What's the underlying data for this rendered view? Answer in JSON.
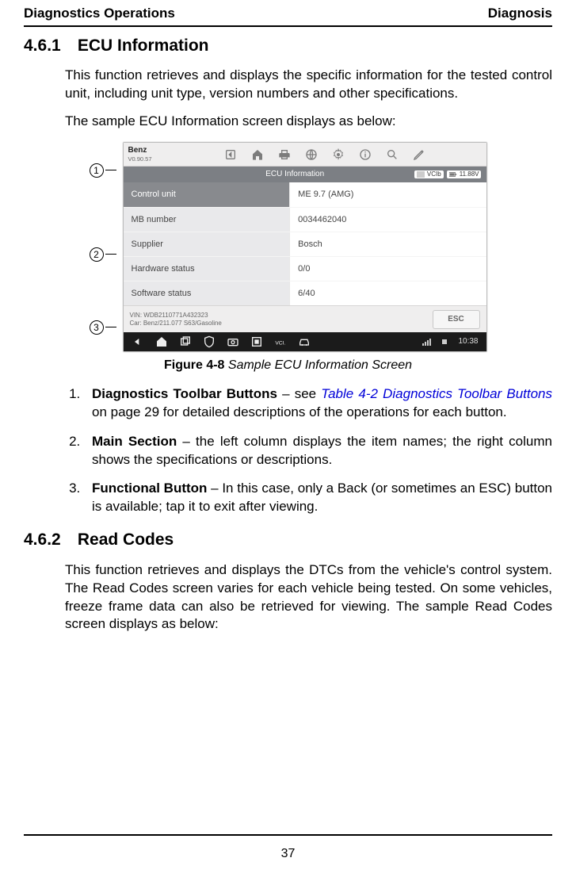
{
  "running_head": {
    "left": "Diagnostics Operations",
    "right": "Diagnosis"
  },
  "sections": {
    "s461": {
      "num": "4.6.1",
      "title": "ECU Information"
    },
    "s462": {
      "num": "4.6.2",
      "title": "Read Codes"
    }
  },
  "paras": {
    "p1": "This function retrieves and displays the specific information for the tested control unit, including unit type, version numbers and other specifications.",
    "p2": "The sample ECU Information screen displays as below:",
    "p3": "This function retrieves and displays the DTCs from the vehicle's control system. The Read Codes screen varies for each vehicle being tested. On some vehicles, freeze frame data can also be retrieved for viewing. The sample Read Codes screen displays as below:"
  },
  "callouts": {
    "c1": "1",
    "c2": "2",
    "c3": "3"
  },
  "screenshot": {
    "brand": {
      "name": "Benz",
      "version": "V0.90.57"
    },
    "subbar": {
      "title": "ECU Information",
      "vcib_label": "VCIb",
      "battery": "11.88V"
    },
    "rows": [
      {
        "name": "Control unit",
        "value": "ME 9.7 (AMG)",
        "header": true
      },
      {
        "name": "MB number",
        "value": "0034462040"
      },
      {
        "name": "Supplier",
        "value": "Bosch"
      },
      {
        "name": "Hardware status",
        "value": "0/0"
      },
      {
        "name": "Software status",
        "value": "6/40"
      }
    ],
    "footer": {
      "vin_line1": "VIN: WDB2110771A432323",
      "vin_line2": "Car: Benz/211.077 S63/Gasoline",
      "esc": "ESC"
    },
    "sysbar": {
      "time": "10:38"
    },
    "icons": {
      "back": "back-icon",
      "home": "home-icon",
      "print": "print-icon",
      "globe": "globe-icon",
      "settings": "settings-icon",
      "about": "about-icon",
      "search": "search-icon",
      "edit": "pencil-icon",
      "bottom": [
        "back-icon",
        "home-icon",
        "recent-icon",
        "shield-icon",
        "camera-icon",
        "screenshot-icon",
        "vci-icon",
        "car-icon"
      ]
    }
  },
  "figure": {
    "lead": "Figure 4-8",
    "title": "Sample ECU Information Screen"
  },
  "list": {
    "i1_lead": "Diagnostics Toolbar Buttons",
    "i1_dash": " – see ",
    "i1_link": "Table 4-2 Diagnostics Toolbar Buttons",
    "i1_tail": " on page 29 for detailed descriptions of the operations for each button.",
    "i2_lead": "Main Section",
    "i2_tail": " – the left column displays the item names; the right column shows the specifications or descriptions.",
    "i3_lead": "Functional Button",
    "i3_tail": " – In this case, only a Back (or sometimes an ESC) button is available; tap it to exit after viewing."
  },
  "page_number": "37"
}
